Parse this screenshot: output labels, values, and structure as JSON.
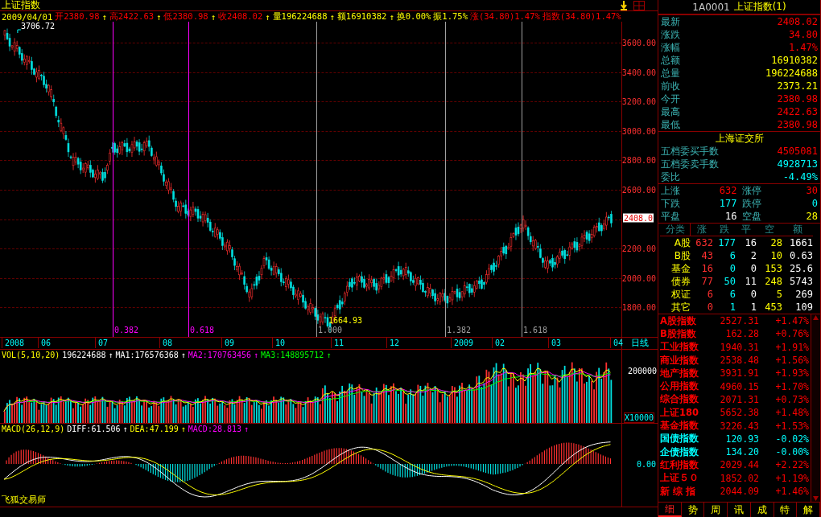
{
  "title": "上证指数",
  "info_bar": [
    {
      "text": "2009/04/01",
      "color": "#ffff00"
    },
    {
      "text": "开2380.98",
      "arrow": "↑",
      "color": "#ff0000"
    },
    {
      "text": "高2422.63",
      "arrow": "↑",
      "color": "#ff0000"
    },
    {
      "text": "低2380.98",
      "arrow": "↑",
      "color": "#ff0000"
    },
    {
      "text": "收2408.02",
      "arrow": "↑",
      "color": "#ff0000"
    },
    {
      "text": "量196224688",
      "arrow": "↑",
      "color": "#ffff00"
    },
    {
      "text": "额16910382",
      "arrow": "↑",
      "color": "#ffff00"
    },
    {
      "text": "换0.00%",
      "color": "#ffff00"
    },
    {
      "text": "振1.75%",
      "color": "#ffff00"
    },
    {
      "text": "涨(34.80)1.47%",
      "color": "#ff0000"
    },
    {
      "text": "指数(34.80)1.47%",
      "color": "#ff0000"
    }
  ],
  "main_chart": {
    "high_label": "3706.72",
    "low_label": "1664.93",
    "y_axis": [
      "3600.00",
      "3400.00",
      "3200.00",
      "3000.00",
      "2800.00",
      "2600.00",
      "2200.00",
      "2000.00",
      "1800.00"
    ],
    "current_price": "2408.0",
    "fib_lines": [
      {
        "label": "0.382",
        "color": "#ff00ff"
      },
      {
        "label": "0.618",
        "color": "#ff00ff"
      },
      {
        "label": "1.000",
        "color": "#a0a0a0"
      },
      {
        "label": "1.382",
        "color": "#a0a0a0"
      },
      {
        "label": "1.618",
        "color": "#a0a0a0"
      }
    ]
  },
  "date_axis": {
    "labels": [
      "2008",
      "06",
      "07",
      "08",
      "09",
      "10",
      "11",
      "12",
      "2009",
      "02",
      "03",
      "04"
    ],
    "period": "日线"
  },
  "volume": {
    "legend": [
      {
        "text": "VOL(5,10,20)",
        "color": "#ffff00"
      },
      {
        "text": "196224688",
        "arrow": "↑",
        "color": "#ffffff"
      },
      {
        "text": "MA1:176576368",
        "arrow": "↑",
        "color": "#ffffff"
      },
      {
        "text": "MA2:170763456",
        "arrow": "↑",
        "color": "#ff00ff"
      },
      {
        "text": "MA3:148895712",
        "arrow": "↑",
        "color": "#00ff00"
      }
    ],
    "axis_label": "200000",
    "unit": "X10000"
  },
  "macd": {
    "legend": [
      {
        "text": "MACD(26,12,9)",
        "color": "#ffff00"
      },
      {
        "text": "DIFF:61.506",
        "arrow": "↑",
        "color": "#ffffff"
      },
      {
        "text": "DEA:47.199",
        "arrow": "↑",
        "color": "#ffff00"
      },
      {
        "text": "MACD:28.813",
        "arrow": "↑",
        "color": "#ff00ff"
      }
    ],
    "axis_label": "0.00"
  },
  "brand": "飞狐交易师",
  "right_panel": {
    "code": "1A0001",
    "name": "上证指数(1)",
    "quote": [
      {
        "label": "最新",
        "value": "2408.02",
        "color": "#ff0000"
      },
      {
        "label": "涨跌",
        "value": "34.80",
        "color": "#ff0000"
      },
      {
        "label": "涨幅",
        "value": "1.47%",
        "color": "#ff0000"
      },
      {
        "label": "总额",
        "value": "16910382",
        "color": "#ffff00"
      },
      {
        "label": "总量",
        "value": "196224688",
        "color": "#ffff00"
      },
      {
        "label": "前收",
        "value": "2373.21",
        "color": "#ffff00"
      },
      {
        "label": "今开",
        "value": "2380.98",
        "color": "#ff0000"
      },
      {
        "label": "最高",
        "value": "2422.63",
        "color": "#ff0000"
      },
      {
        "label": "最低",
        "value": "2380.98",
        "color": "#ff0000"
      }
    ],
    "exchange": "上海证交所",
    "orders": [
      {
        "label": "五档委买手数",
        "value": "4505081",
        "color": "#ff0000"
      },
      {
        "label": "五档委卖手数",
        "value": "4928713",
        "color": "#00ffff"
      },
      {
        "label": "委比",
        "value": "-4.49%",
        "color": "#00ffff"
      }
    ],
    "breadth": [
      {
        "label": "上涨",
        "value": "632",
        "color": "#ff0000"
      },
      {
        "label": "涨停",
        "value": "30",
        "color": "#ff0000"
      },
      {
        "label": "下跌",
        "value": "177",
        "color": "#00ffff"
      },
      {
        "label": "跌停",
        "value": "0",
        "color": "#00ffff"
      },
      {
        "label": "平盘",
        "value": "16",
        "color": "#ffffff"
      },
      {
        "label": "空盘",
        "value": "28",
        "color": "#ffff00"
      }
    ],
    "category_columns": [
      "分类",
      "涨",
      "跌",
      "平",
      "空",
      "额"
    ],
    "categories": [
      {
        "name": "A股",
        "values": [
          "632",
          "177",
          "16",
          "28",
          "1661"
        ]
      },
      {
        "name": "B股",
        "values": [
          "43",
          "6",
          "2",
          "10",
          "0.63"
        ]
      },
      {
        "name": "基金",
        "values": [
          "16",
          "0",
          "0",
          "153",
          "25.6"
        ]
      },
      {
        "name": "债券",
        "values": [
          "77",
          "50",
          "11",
          "248",
          "5743"
        ]
      },
      {
        "name": "权证",
        "values": [
          "6",
          "6",
          "0",
          "5",
          "269"
        ]
      },
      {
        "name": "其它",
        "values": [
          "0",
          "1",
          "1",
          "453",
          "109"
        ]
      }
    ],
    "indices": [
      {
        "name": "A股指数",
        "value": "2527.31",
        "change": "+1.47%",
        "color": "#ff0000"
      },
      {
        "name": "B股指数",
        "value": "162.28",
        "change": "+0.76%",
        "color": "#ff0000"
      },
      {
        "name": "工业指数",
        "value": "1940.31",
        "change": "+1.91%",
        "color": "#ff0000"
      },
      {
        "name": "商业指数",
        "value": "2538.48",
        "change": "+1.56%",
        "color": "#ff0000"
      },
      {
        "name": "地产指数",
        "value": "3931.91",
        "change": "+1.93%",
        "color": "#ff0000"
      },
      {
        "name": "公用指数",
        "value": "4960.15",
        "change": "+1.70%",
        "color": "#ff0000"
      },
      {
        "name": "综合指数",
        "value": "2071.31",
        "change": "+0.73%",
        "color": "#ff0000"
      },
      {
        "name": "上证180",
        "value": "5652.38",
        "change": "+1.48%",
        "color": "#ff0000"
      },
      {
        "name": "基金指数",
        "value": "3226.43",
        "change": "+1.53%",
        "color": "#ff0000"
      },
      {
        "name": "国债指数",
        "value": "120.93",
        "change": "-0.02%",
        "color": "#00ffff"
      },
      {
        "name": "企债指数",
        "value": "134.20",
        "change": "-0.00%",
        "color": "#00ffff"
      },
      {
        "name": "红利指数",
        "value": "2029.44",
        "change": "+2.22%",
        "color": "#ff0000"
      },
      {
        "name": "上证５０",
        "value": "1852.02",
        "change": "+1.19%",
        "color": "#ff0000"
      },
      {
        "name": "新 综 指",
        "value": "2044.09",
        "change": "+1.46%",
        "color": "#ff0000"
      }
    ],
    "tabs": [
      {
        "label": "细",
        "selected": true
      },
      {
        "label": "势",
        "selected": false
      },
      {
        "label": "周",
        "selected": false
      },
      {
        "label": "讯",
        "selected": false
      },
      {
        "label": "成",
        "selected": false
      },
      {
        "label": "特",
        "selected": false
      },
      {
        "label": "解",
        "selected": false
      }
    ]
  }
}
